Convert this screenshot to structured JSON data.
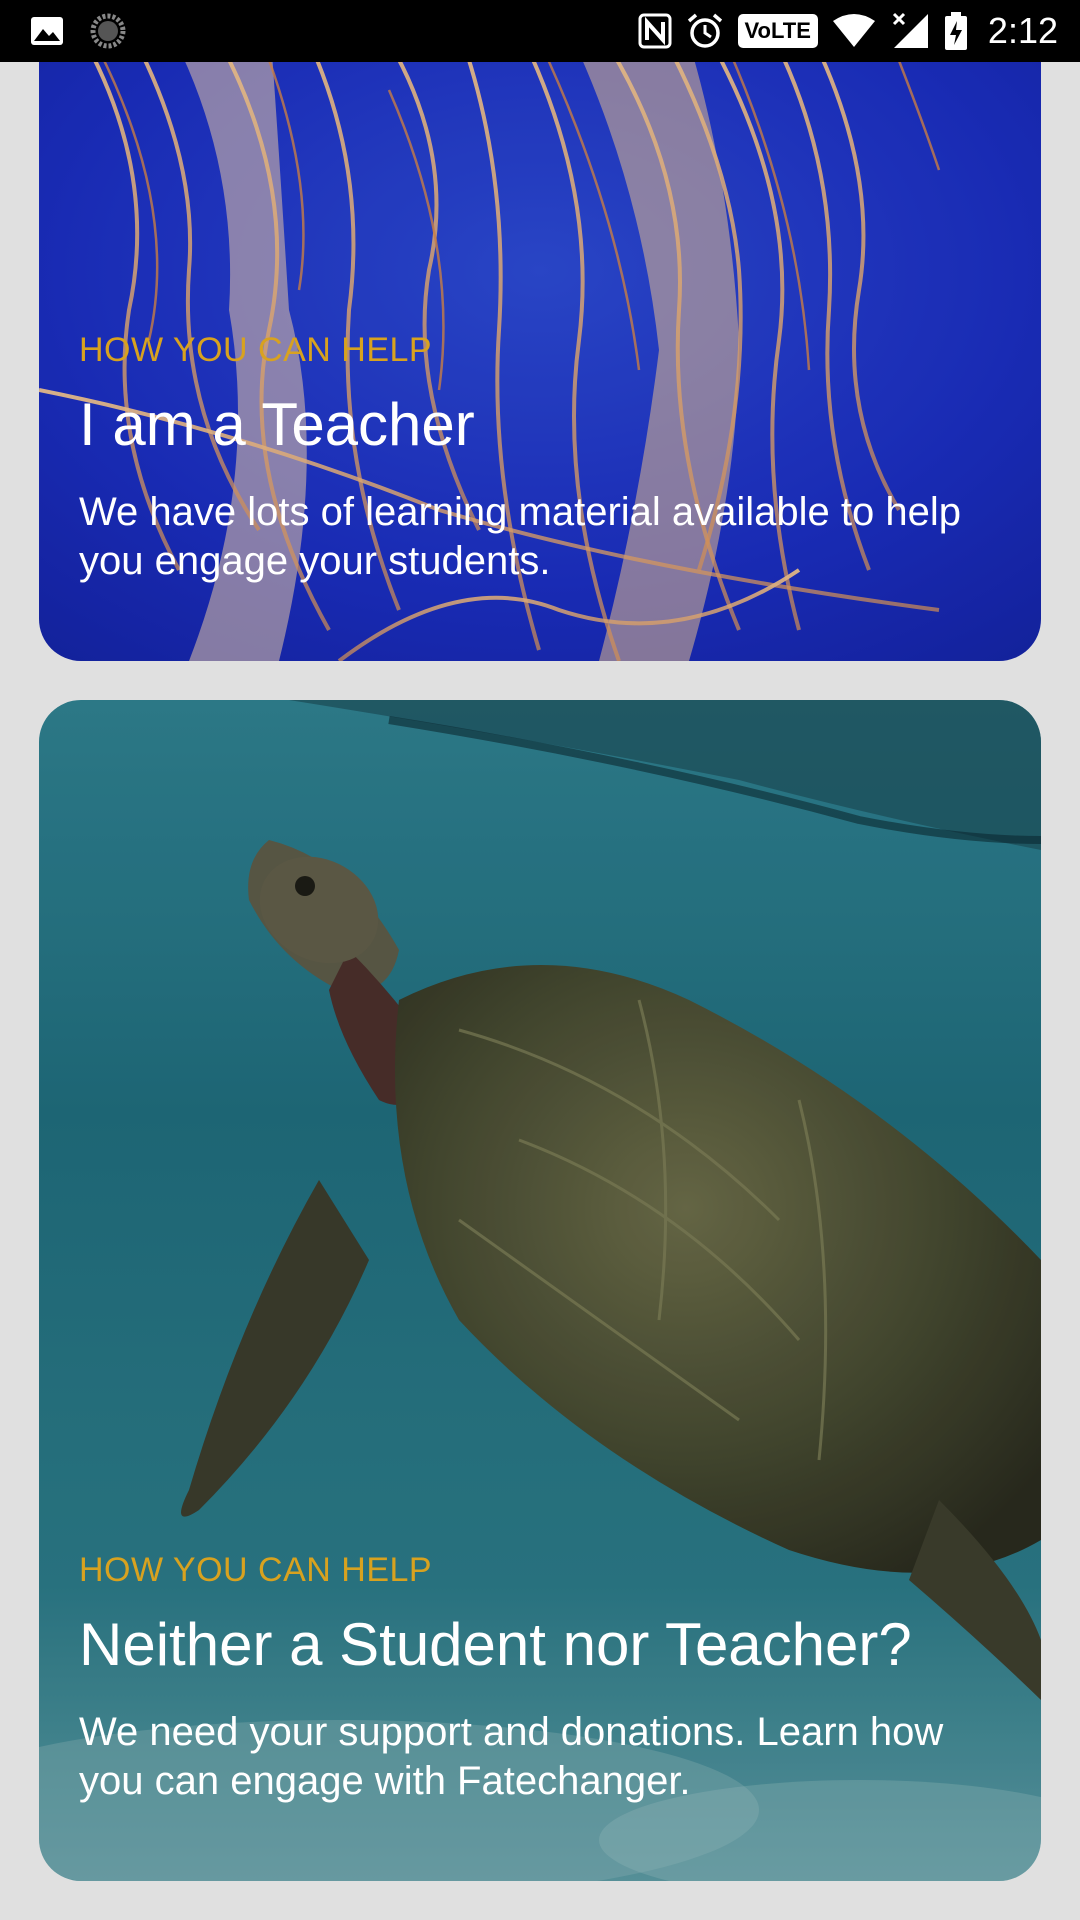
{
  "status_bar": {
    "time": "2:12",
    "volte": "VoLTE",
    "icons": [
      "image-icon",
      "sync-icon",
      "nfc-icon",
      "alarm-icon",
      "volte-icon",
      "wifi-icon",
      "signal-icon",
      "battery-charging-icon"
    ]
  },
  "cards": [
    {
      "eyebrow": "HOW YOU CAN HELP",
      "title": "I am a Teacher",
      "description": "We have lots of learning material available to help you engage your students.",
      "image": "jellyfish-photo"
    },
    {
      "eyebrow": "HOW YOU CAN HELP",
      "title": "Neither a Student nor Teacher?",
      "description": "We need your support and donations. Learn how you can engage with Fatechanger.",
      "image": "sea-turtle-photo"
    }
  ],
  "colors": {
    "eyebrow": "#d8a21f",
    "background": "#e0e0e0",
    "status_bar": "#000000"
  }
}
